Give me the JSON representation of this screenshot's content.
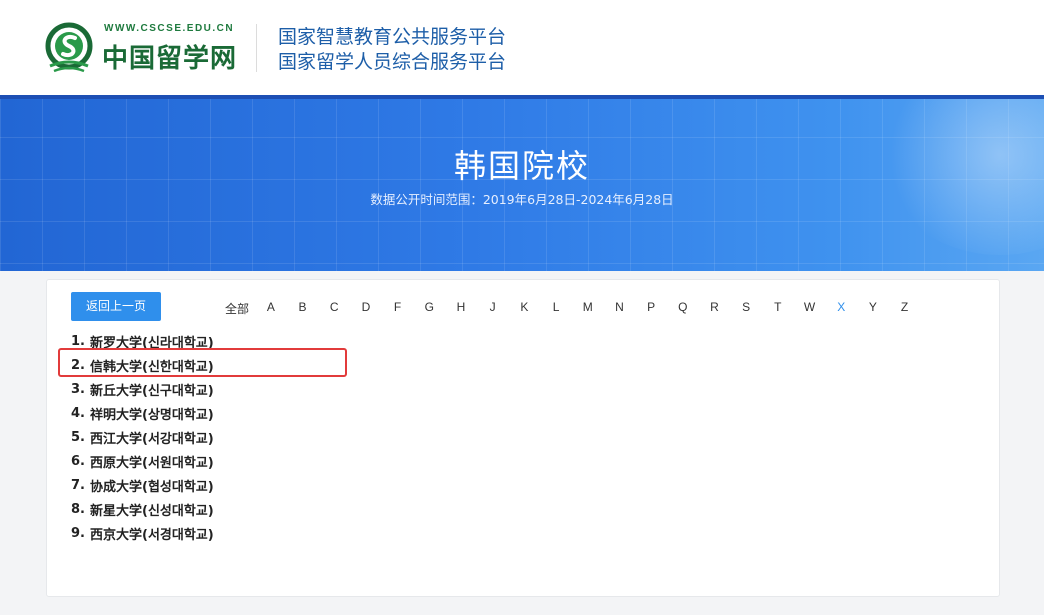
{
  "header": {
    "logo_url": "WWW.CSCSE.EDU.CN",
    "logo_name": "中国留学网",
    "platform_line1": "国家智慧教育公共服务平台",
    "platform_line2": "国家留学人员综合服务平台"
  },
  "banner": {
    "title": "韩国院校",
    "subtitle": "数据公开时间范围：2019年6月28日-2024年6月28日"
  },
  "nav": {
    "back_label": "返回上一页",
    "letters": [
      "全部",
      "A",
      "B",
      "C",
      "D",
      "F",
      "G",
      "H",
      "J",
      "K",
      "L",
      "M",
      "N",
      "P",
      "Q",
      "R",
      "S",
      "T",
      "W",
      "X",
      "Y",
      "Z"
    ],
    "active_letter": "X"
  },
  "schools": [
    {
      "num": "1.",
      "name": "新罗大学(신라대학교)"
    },
    {
      "num": "2.",
      "name": "信韩大学(신한대학교)"
    },
    {
      "num": "3.",
      "name": "新丘大学(신구대학교)"
    },
    {
      "num": "4.",
      "name": "祥明大学(상명대학교)"
    },
    {
      "num": "5.",
      "name": "西江大学(서강대학교)"
    },
    {
      "num": "6.",
      "name": "西原大学(서원대학교)"
    },
    {
      "num": "7.",
      "name": "协成大学(협성대학교)"
    },
    {
      "num": "8.",
      "name": "新星大学(신성대학교)"
    },
    {
      "num": "9.",
      "name": "西京大学(서경대학교)"
    }
  ],
  "colors": {
    "accent": "#2f8fec",
    "highlight_border": "#e23b3b",
    "banner_blue": "#2f7ae6",
    "logo_green": "#1a6a36",
    "platform_blue": "#1d5ea8"
  }
}
